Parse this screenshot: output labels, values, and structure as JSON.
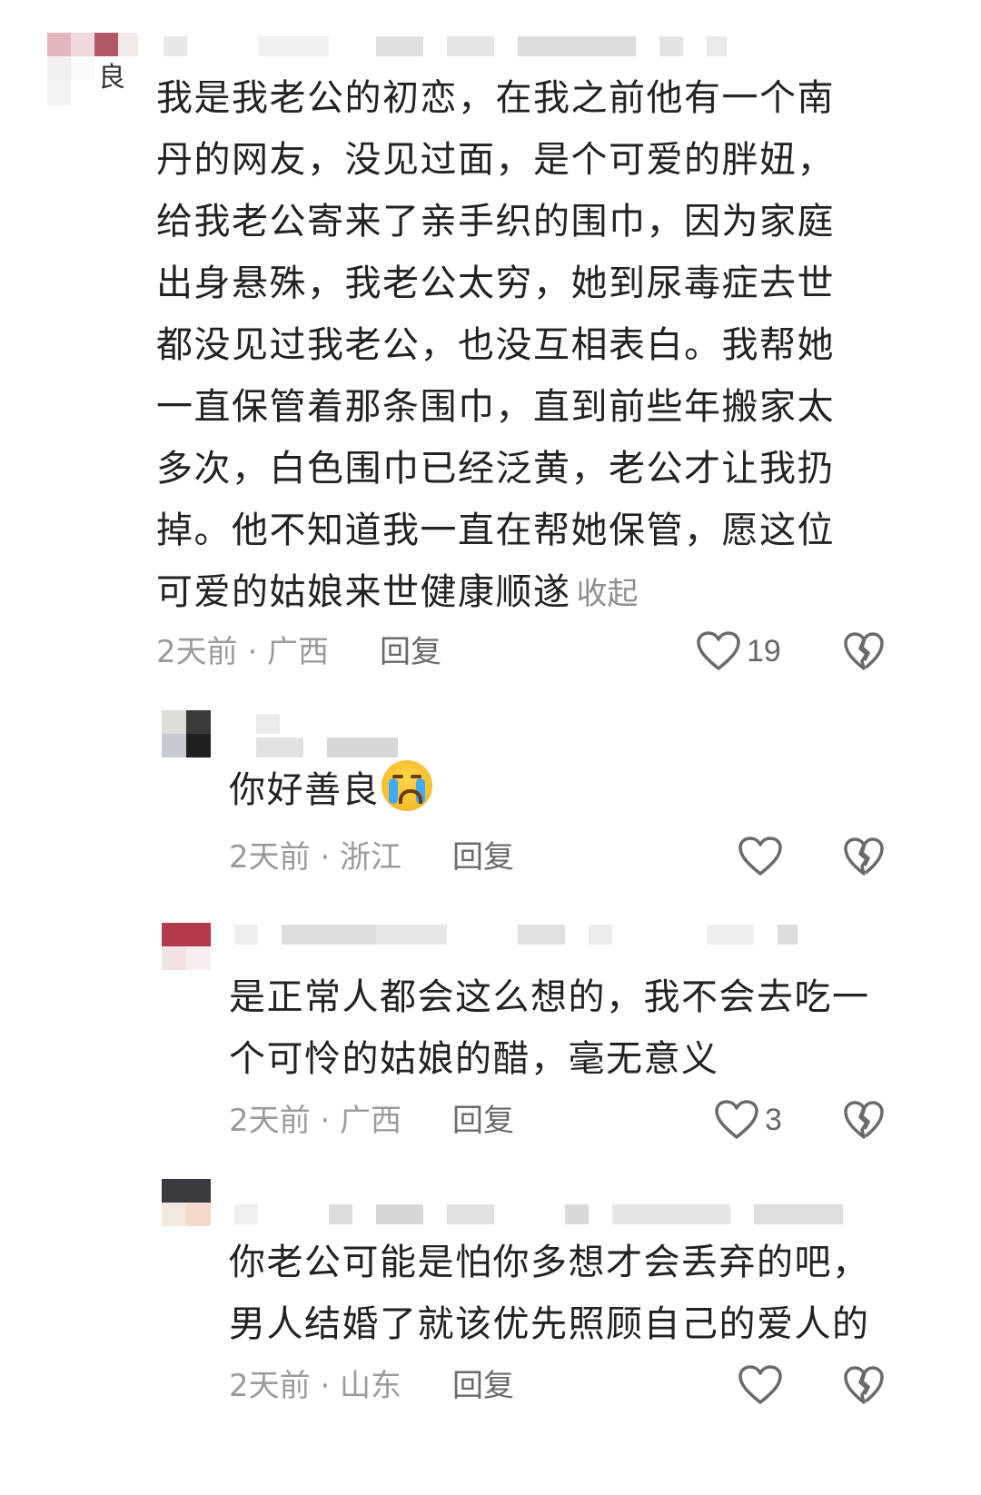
{
  "comments": [
    {
      "text": "我是我老公的初恋，在我之前他有一个南\n丹的网友，没见过面，是个可爱的胖妞，\n给我老公寄来了亲手织的围巾，因为家庭\n出身悬殊，我老公太穷，她到尿毒症去世\n都没见过我老公，也没互相表白。我帮她\n一直保管着那条围巾，直到前些年搬家太\n多次，白色围巾已经泛黄，老公才让我扔\n掉。他不知道我一直在帮她保管，愿这位\n可爱的姑娘来世健康顺遂",
      "collapse_label": "收起",
      "avatar_glyph": "良",
      "time_location": "2天前 · 广西",
      "reply_label": "回复",
      "like_count": "19"
    },
    {
      "text": "你好善良",
      "emoji": "loudly-crying-face",
      "time_location": "2天前 · 浙江",
      "reply_label": "回复",
      "like_count": ""
    },
    {
      "text": "是正常人都会这么想的，我不会去吃一\n个可怜的姑娘的醋，毫无意义",
      "time_location": "2天前 · 广西",
      "reply_label": "回复",
      "like_count": "3"
    },
    {
      "text": "你老公可能是怕你多想才会丢弃的吧，\n男人结婚了就该优先照顾自己的爱人的",
      "time_location": "2天前 · 山东",
      "reply_label": "回复",
      "like_count": ""
    }
  ],
  "icons": {
    "like": "heart-outline-icon",
    "dislike": "broken-heart-outline-icon"
  },
  "colors": {
    "text": "#222222",
    "meta": "#9b9b9b",
    "icon": "#6a6a6a"
  }
}
